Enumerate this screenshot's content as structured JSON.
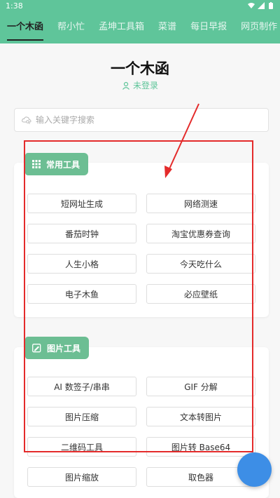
{
  "status_bar": {
    "time": "1:38"
  },
  "tabs": [
    {
      "label": "一个木函",
      "active": true
    },
    {
      "label": "帮小忙"
    },
    {
      "label": "孟坤工具箱"
    },
    {
      "label": "菜谱"
    },
    {
      "label": "每日早报"
    },
    {
      "label": "网页制作"
    }
  ],
  "header": {
    "title": "一个木函",
    "login": "未登录"
  },
  "search": {
    "placeholder": "输入关键字搜索"
  },
  "sections": [
    {
      "title": "常用工具",
      "items": [
        "短网址生成",
        "网络测速",
        "番茄时钟",
        "淘宝优惠券查询",
        "人生小格",
        "今天吃什么",
        "电子木鱼",
        "必应壁纸"
      ]
    },
    {
      "title": "图片工具",
      "items": [
        "AI 数签子/串串",
        "GIF 分解",
        "图片压缩",
        "文本转图片",
        "二维码工具",
        "图片转 Base64",
        "图片缩放",
        "取色器"
      ]
    }
  ],
  "colors": {
    "brand": "#5fc59a",
    "badge": "#6cbe93",
    "annotation": "#e42b2b",
    "fab": "#3d8ee6"
  }
}
